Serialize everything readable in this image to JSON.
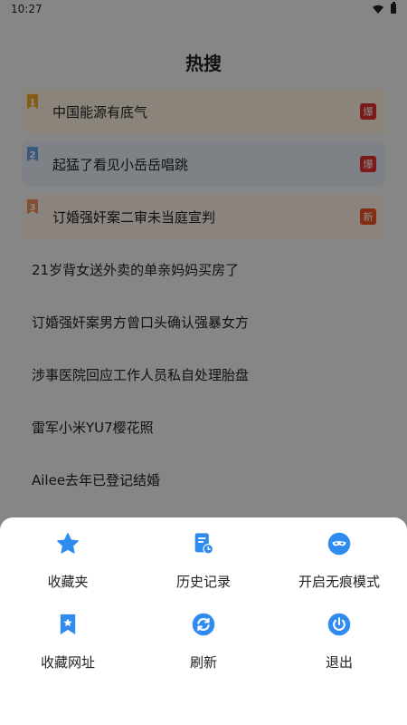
{
  "status_bar": {
    "time": "10:27"
  },
  "page": {
    "title": "热搜"
  },
  "hot_list": [
    {
      "rank": "1",
      "text": "中国能源有底气",
      "badge": "爆"
    },
    {
      "rank": "2",
      "text": "起猛了看见小岳岳唱跳",
      "badge": "爆"
    },
    {
      "rank": "3",
      "text": "订婚强奸案二审未当庭宣判",
      "badge": "新"
    },
    {
      "text": "21岁背女送外卖的单亲妈妈买房了"
    },
    {
      "text": "订婚强奸案男方曾口头确认强暴女方"
    },
    {
      "text": "涉事医院回应工作人员私自处理胎盘"
    },
    {
      "text": "雷军小米YU7樱花照"
    },
    {
      "text": "Ailee去年已登记结婚"
    }
  ],
  "menu": {
    "items": [
      {
        "label": "收藏夹",
        "icon": "star-icon"
      },
      {
        "label": "历史记录",
        "icon": "history-icon"
      },
      {
        "label": "开启无痕模式",
        "icon": "incognito-mask-icon"
      },
      {
        "label": "收藏网址",
        "icon": "bookmark-icon"
      },
      {
        "label": "刷新",
        "icon": "refresh-icon"
      },
      {
        "label": "退出",
        "icon": "power-icon"
      }
    ]
  },
  "colors": {
    "accent": "#2f8bf0",
    "hot_badge": "#e0302f",
    "new_badge": "#ee5522",
    "rank1": "#f1a92a",
    "rank2": "#6ea1de",
    "rank3": "#f0905a"
  }
}
